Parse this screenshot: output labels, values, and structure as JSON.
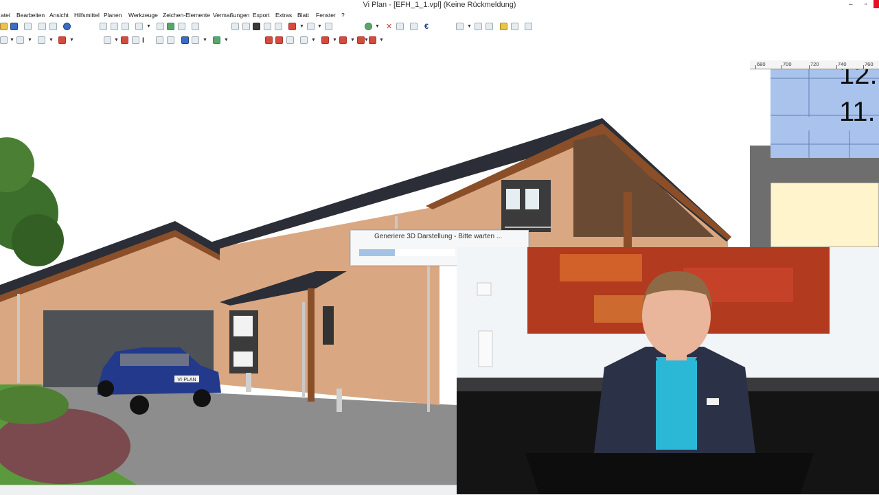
{
  "app": {
    "title": "Vi Plan - [EFH_1_1.vpl] (Keine Rückmeldung)",
    "minimize_glyph": "–",
    "maximize_glyph": "▫"
  },
  "menu": [
    "atei",
    "Bearbeiten",
    "Ansicht",
    "Hilfsmittel",
    "Planen",
    "Werkzeuge",
    "Zeichen-Elemente",
    "Vermaßungen",
    "Export",
    "Extras",
    "Blatt",
    "Fenster",
    "?"
  ],
  "toolbar": {
    "euro_glyph": "€",
    "bold_glyph": "b"
  },
  "ruler": [
    "680",
    "700",
    "720",
    "740",
    "760"
  ],
  "plan": {
    "label_12": "12.",
    "label_11": "11."
  },
  "car": {
    "plate": "VI·PLAN"
  },
  "dialog": {
    "message": "Generiere 3D Darstellung - Bitte warten ...",
    "progress": 0.37
  },
  "colors": {
    "facade": "#d9a882",
    "roof": "#2b2e36",
    "wood": "#8a4f28",
    "plan_blue": "#a9c3ec",
    "plan_yellow": "#fff4cc",
    "plan_wall": "#6e6e6e",
    "progress": "#a5c2e6"
  }
}
